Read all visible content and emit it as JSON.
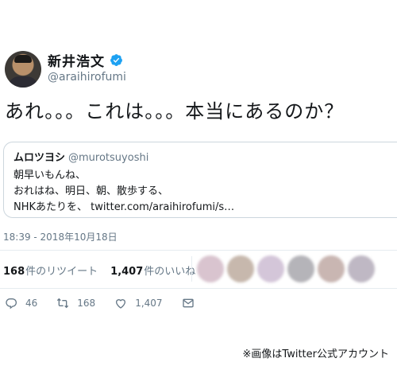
{
  "author": {
    "name": "新井浩文",
    "handle": "@araihirofumi",
    "verified_icon": "verified-badge-icon"
  },
  "tweet": {
    "text": "あれ。。。これは。。。本当にあるのか？",
    "timestamp": "18:39 - 2018年10月18日"
  },
  "quoted_tweet": {
    "name": "ムロツヨシ",
    "handle": "@murotsuyoshi",
    "lines": [
      "朝早いもんね、",
      "おれはね、明日、朝、散歩する、",
      "NHKあたりを、 twitter.com/araihirofumi/s…"
    ]
  },
  "stats": {
    "retweets_count": "168",
    "retweets_label": "件のリツイート",
    "likes_count": "1,407",
    "likes_label": "件のいいね"
  },
  "actions": {
    "reply_count": "46",
    "retweet_count": "168",
    "like_count": "1,407"
  },
  "caption": "※画像はTwitter公式アカウント",
  "colors": {
    "text": "#14171a",
    "secondary": "#657786",
    "verified": "#1da1f2",
    "border": "#ccd6dd"
  }
}
